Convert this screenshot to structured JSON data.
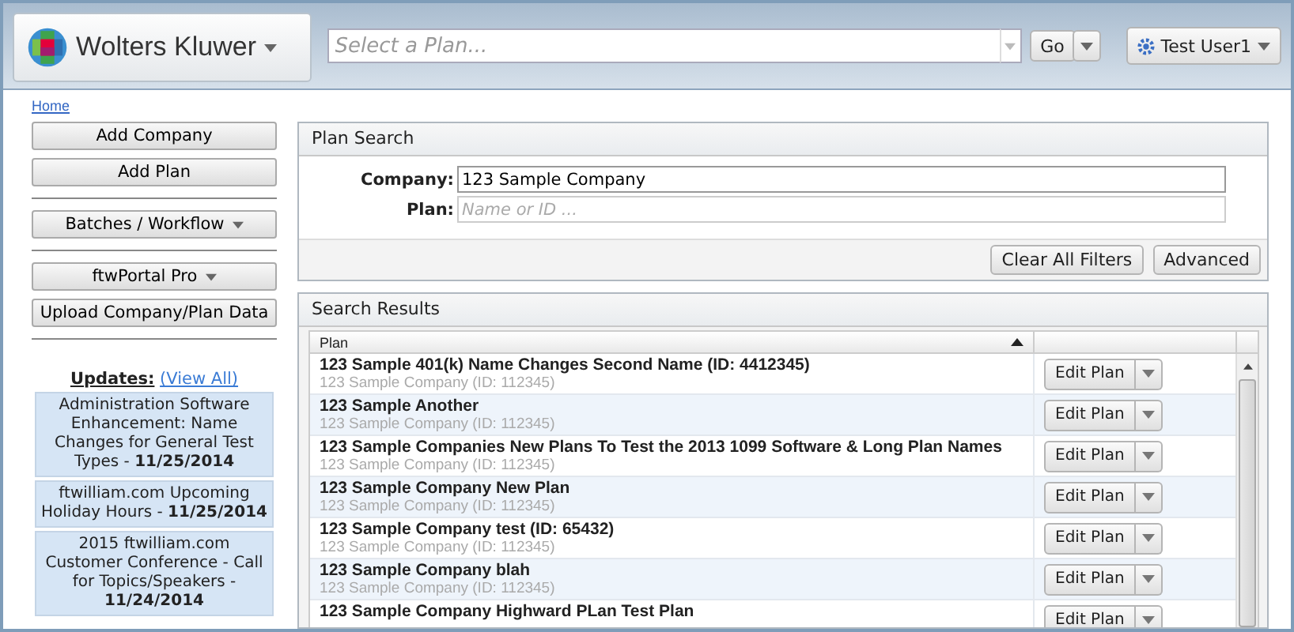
{
  "header": {
    "brand": "Wolters Kluwer",
    "plan_select": {
      "placeholder": "Select a Plan..."
    },
    "go_button": "Go",
    "user": "Test User1"
  },
  "breadcrumb": "Home",
  "sidebar": {
    "buttons": [
      {
        "kind": "button",
        "label": "Add Company"
      },
      {
        "kind": "button",
        "label": "Add Plan"
      },
      {
        "kind": "divider"
      },
      {
        "kind": "dropdown",
        "label": "Batches / Workflow"
      },
      {
        "kind": "divider"
      },
      {
        "kind": "dropdown",
        "label": "ftwPortal Pro"
      },
      {
        "kind": "button",
        "label": "Upload Company/Plan Data"
      },
      {
        "kind": "divider"
      }
    ],
    "updates_title": "Updates:",
    "view_all": "(View All)",
    "updates": [
      "Administration Software Enhancement: Name Changes for General Test Types - **11/25/2014**",
      "ftwilliam.com Upcoming Holiday Hours - **11/25/2014**",
      "2015 ftwilliam.com Customer Conference - Call for Topics/Speakers - **11/24/2014**"
    ]
  },
  "plan_search": {
    "title": "Plan Search",
    "fields": [
      {
        "label": "Company:",
        "value": "123 Sample Company"
      },
      {
        "label": "Plan:",
        "placeholder": "Name or ID ..."
      }
    ],
    "buttons": [
      "Clear All Filters",
      "Advanced"
    ]
  },
  "search_results": {
    "title": "Search Results",
    "columns": [
      {
        "label": "Plan",
        "sort_ascending": true
      }
    ],
    "rows": [
      {
        "plan": "123 Sample 401(k) Name Changes Second Name (ID: 4412345)",
        "company": "123 Sample Company (ID: 112345)",
        "action": "Edit Plan"
      },
      {
        "plan": "123 Sample Another",
        "company": "123 Sample Company (ID: 112345)",
        "action": "Edit Plan"
      },
      {
        "plan": "123 Sample Companies New Plans To Test the 2013 1099 Software & Long Plan Names",
        "company": "123 Sample Company (ID: 112345)",
        "action": "Edit Plan"
      },
      {
        "plan": "123 Sample Company New Plan",
        "company": "123 Sample Company (ID: 112345)",
        "action": "Edit Plan"
      },
      {
        "plan": "123 Sample Company test (ID: 65432)",
        "company": "123 Sample Company (ID: 112345)",
        "action": "Edit Plan"
      },
      {
        "plan": "123 Sample Company blah",
        "company": "123 Sample Company (ID: 112345)",
        "action": "Edit Plan"
      },
      {
        "plan": "123 Sample Company Highward PLan Test Plan",
        "action": "Edit Plan"
      }
    ]
  }
}
